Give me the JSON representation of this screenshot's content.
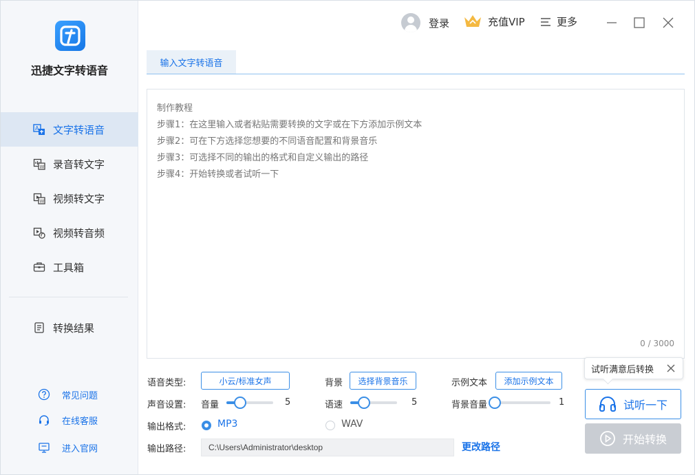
{
  "app": {
    "name": "迅捷文字转语音"
  },
  "sidebar": {
    "items": [
      {
        "label": "文字转语音",
        "icon": "text-to-speech-icon",
        "active": true
      },
      {
        "label": "录音转文字",
        "icon": "audio-to-text-icon"
      },
      {
        "label": "视频转文字",
        "icon": "video-to-text-icon"
      },
      {
        "label": "视频转音频",
        "icon": "video-to-audio-icon"
      },
      {
        "label": "工具箱",
        "icon": "toolbox-icon"
      }
    ],
    "result": {
      "label": "转换结果",
      "icon": "result-list-icon"
    },
    "help": [
      {
        "label": "常见问题",
        "icon": "question-icon"
      },
      {
        "label": "在线客服",
        "icon": "headset-icon"
      },
      {
        "label": "进入官网",
        "icon": "monitor-icon"
      }
    ]
  },
  "topbar": {
    "login": "登录",
    "vip": "充值VIP",
    "more": "更多"
  },
  "tab": {
    "label": "输入文字转语音"
  },
  "editor": {
    "lines": [
      "制作教程",
      "步骤1：在这里输入或者粘贴需要转换的文字或在下方添加示例文本",
      "步骤2：可在下方选择您想要的不同语音配置和背景音乐",
      "步骤3：可选择不同的输出的格式和自定义输出的路径",
      "步骤4：开始转换或者试听一下"
    ],
    "counter": "0 / 3000"
  },
  "settings": {
    "voice_type_label": "语音类型:",
    "voice_type_value": "小云/标准女声",
    "bg_label": "背景",
    "bg_button": "选择背景音乐",
    "sample_label": "示例文本",
    "sample_button": "添加示例文本",
    "sound_label": "声音设置:",
    "volume_label": "音量",
    "volume_value": "5",
    "volume_level": 0.3,
    "speed_label": "语速",
    "speed_value": "5",
    "speed_level": 0.3,
    "bg_volume_label": "背景音量",
    "bg_volume_value": "1",
    "bg_volume_level": 0.0,
    "format_label": "输出格式:",
    "format_mp3": "MP3",
    "format_wav": "WAV",
    "format_selected": "MP3",
    "path_label": "输出路径:",
    "path_value": "C:\\Users\\Administrator\\desktop",
    "change_path": "更改路径"
  },
  "actions": {
    "tooltip": "试听满意后转换",
    "listen": "试听一下",
    "start": "开始转换"
  },
  "colors": {
    "accent": "#1a73e8",
    "sidebar_bg": "#f5f7fa",
    "active_bg": "#dde7f3",
    "disabled": "#c9cdd3"
  }
}
